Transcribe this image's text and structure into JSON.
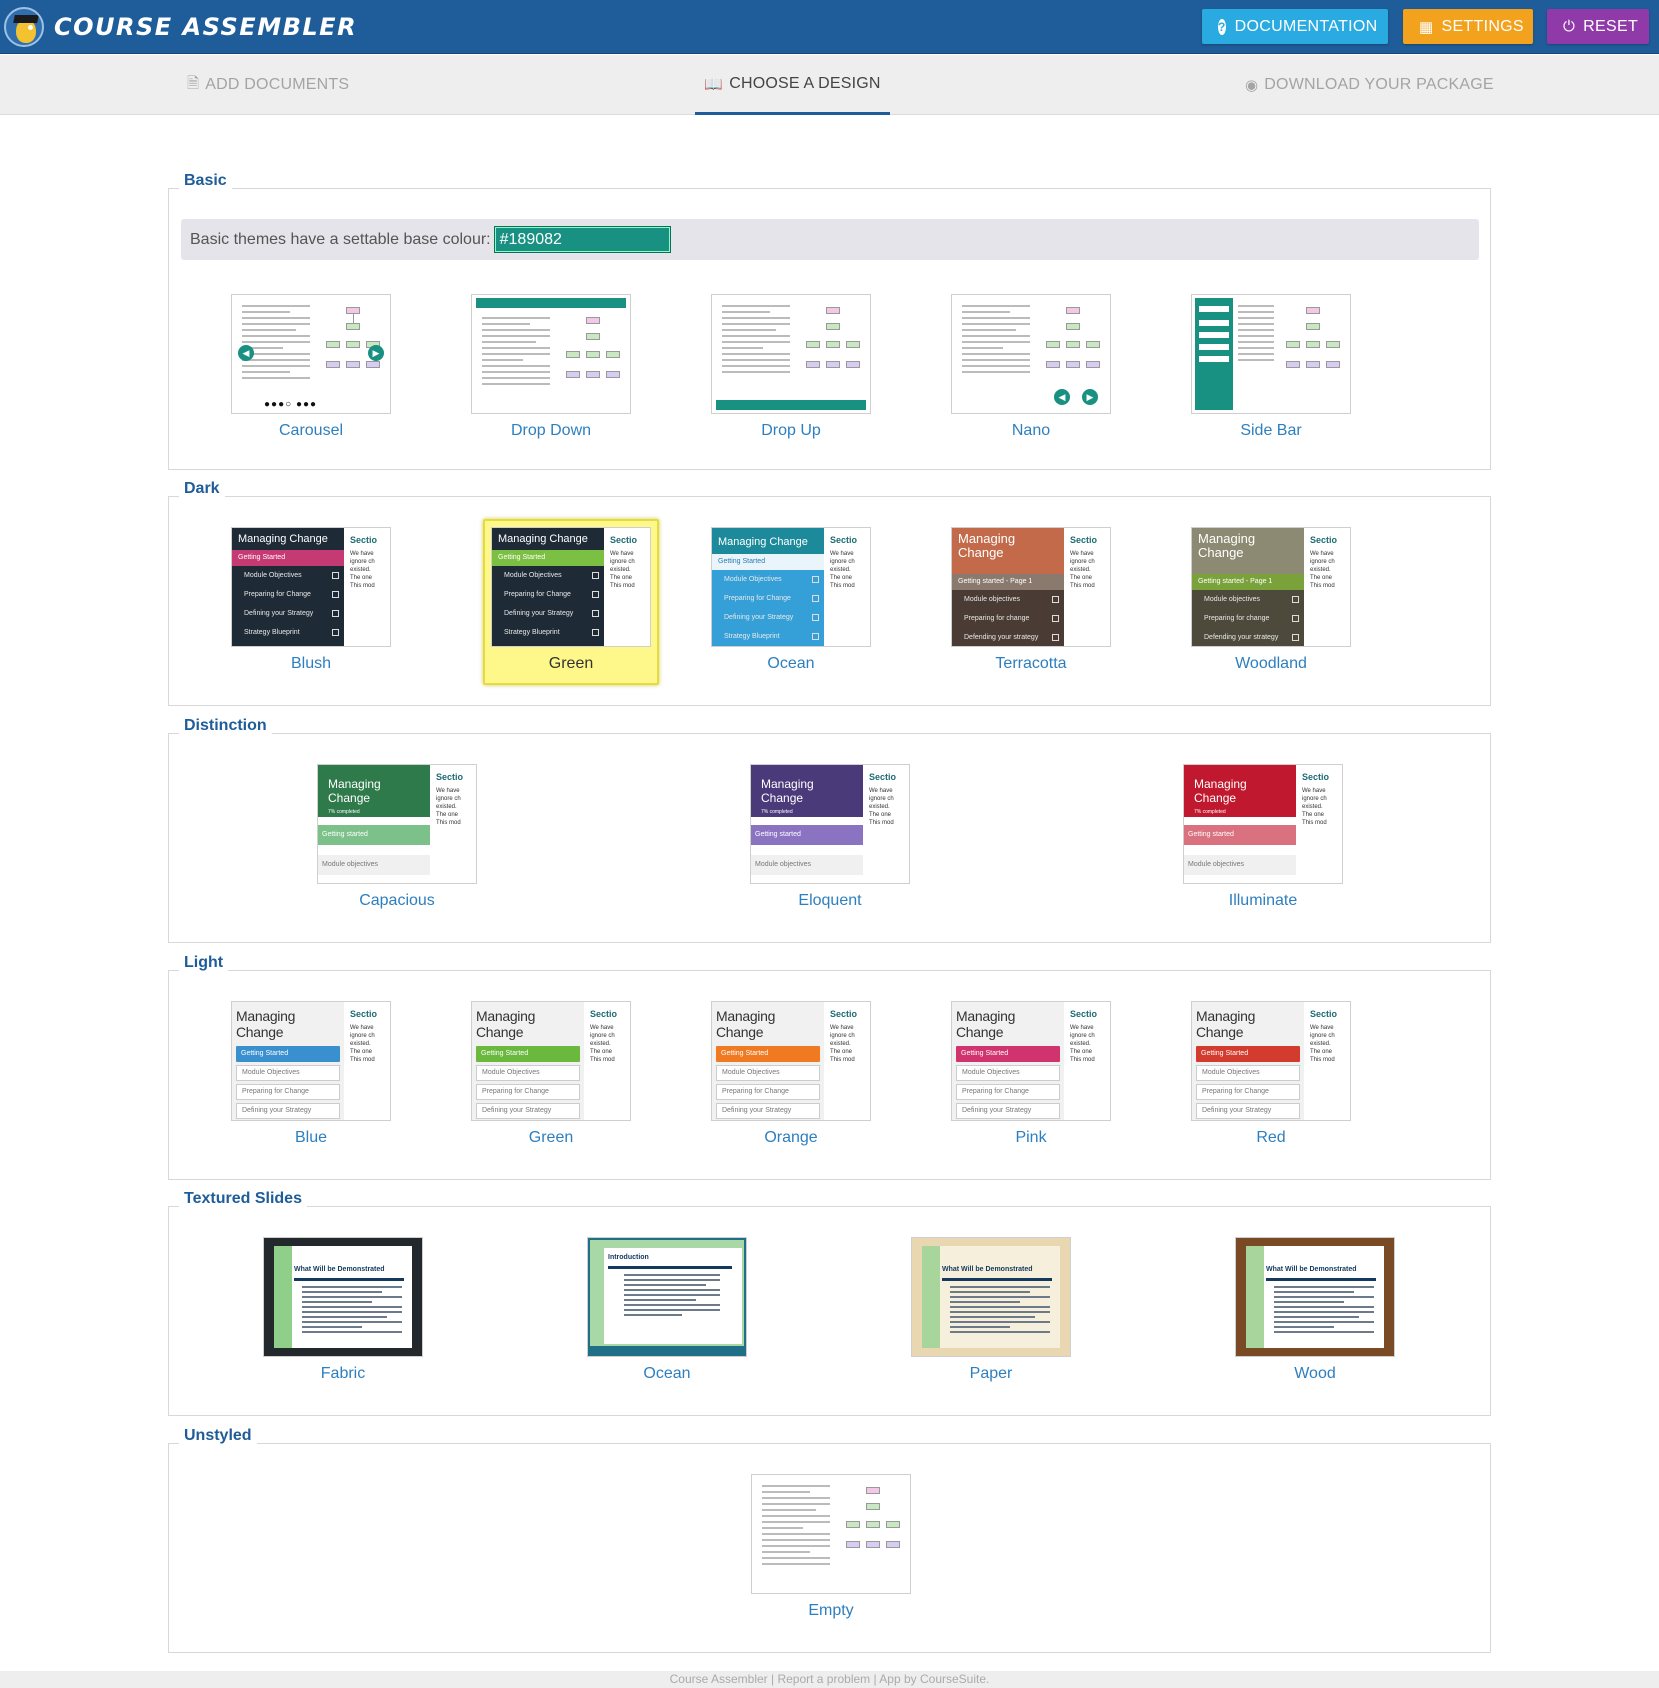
{
  "header": {
    "app_title": "COURSE ASSEMBLER",
    "documentation_label": "DOCUMENTATION",
    "settings_label": "SETTINGS",
    "reset_label": "RESET"
  },
  "steps": {
    "add_documents": "ADD DOCUMENTS",
    "choose_design": "CHOOSE A DESIGN",
    "download_package": "DOWNLOAD YOUR PACKAGE"
  },
  "sections": {
    "basic": {
      "title": "Basic",
      "colour_label": "Basic themes have a settable base colour:",
      "colour_value": "#189082",
      "items": [
        "Carousel",
        "Drop Down",
        "Drop Up",
        "Nano",
        "Side Bar"
      ]
    },
    "dark": {
      "title": "Dark",
      "items": [
        "Blush",
        "Green",
        "Ocean",
        "Terracotta",
        "Woodland"
      ],
      "selected": "Green"
    },
    "distinction": {
      "title": "Distinction",
      "items": [
        "Capacious",
        "Eloquent",
        "Illuminate"
      ]
    },
    "light": {
      "title": "Light",
      "items": [
        "Blue",
        "Green",
        "Orange",
        "Pink",
        "Red"
      ]
    },
    "textured": {
      "title": "Textured Slides",
      "items": [
        "Fabric",
        "Ocean",
        "Paper",
        "Wood"
      ]
    },
    "unstyled": {
      "title": "Unstyled",
      "items": [
        "Empty"
      ]
    }
  },
  "thumb_text": {
    "managing_change": "Managing Change",
    "getting_started": "Getting Started",
    "getting_started_lower": "Getting started",
    "getting_started_page": "Getting started - Page 1",
    "module_objectives": "Module Objectives",
    "module_objectives_lower": "Module objectives",
    "preparing": "Preparing for Change",
    "preparing_lower": "Preparing for change",
    "defining": "Defining your Strategy",
    "defending": "Defending your strategy",
    "blueprint": "Strategy Blueprint",
    "pct_completed": "7% completed",
    "section": "Sectio",
    "body_1": "We have ignore ch existed.",
    "body_2": "The one",
    "body_3": "This mod",
    "what_demonstrated": "What Will be Demonstrated",
    "introduction": "Introduction"
  },
  "colors": {
    "header_bg": "#1e5d99",
    "documentation": "#29abe2",
    "settings": "#f3a21d",
    "reset": "#8f3aa8",
    "base_colour": "#189082",
    "selected_highlight": "#fef88a"
  },
  "footer": {
    "text": "Course Assembler | Report a problem | App by CourseSuite."
  }
}
